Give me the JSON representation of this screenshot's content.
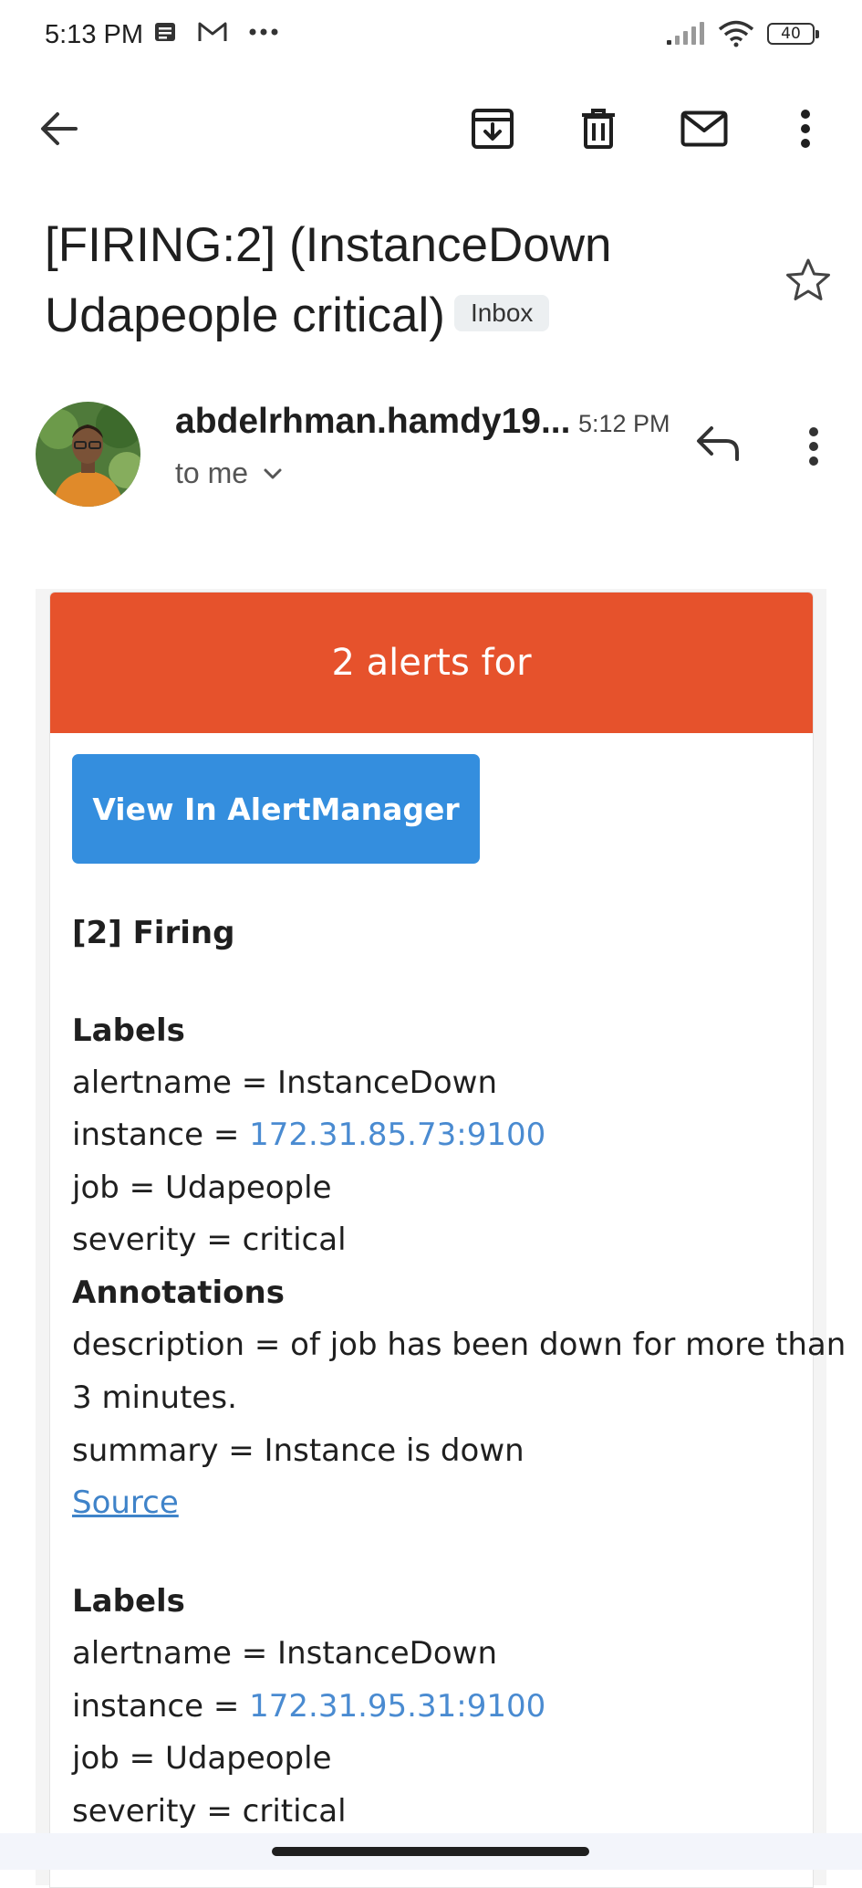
{
  "status_bar": {
    "time": "5:13 PM",
    "battery": "40"
  },
  "message": {
    "subject": "[FIRING:2]  (InstanceDown Udapeople critical)",
    "label": "Inbox",
    "sender": "abdelrhman.hamdy19...",
    "time": "5:12 PM",
    "recipient": "to me"
  },
  "email_body": {
    "banner": "2 alerts for",
    "button": "View In AlertManager",
    "firing_header": "[2] Firing",
    "alerts": [
      {
        "labels_header": "Labels",
        "alertname_prefix": "alertname = ",
        "alertname": "InstanceDown",
        "instance_prefix": "instance = ",
        "instance": "172.31.85.73:9100",
        "job_prefix": "job = ",
        "job": "Udapeople",
        "severity_prefix": "severity = ",
        "severity": "critical",
        "annotations_header": "Annotations",
        "description_line1": "description = of job has been down for more than",
        "description_line2": "3 minutes.",
        "summary": "summary = Instance is down",
        "source": "Source"
      },
      {
        "labels_header": "Labels",
        "alertname_prefix": "alertname = ",
        "alertname": "InstanceDown",
        "instance_prefix": "instance = ",
        "instance": "172.31.95.31:9100",
        "job_prefix": "job = ",
        "job": "Udapeople",
        "severity_prefix": "severity = ",
        "severity": "critical"
      }
    ]
  },
  "icons": {
    "back": "arrow-back-icon",
    "archive": "archive-icon",
    "delete": "trash-icon",
    "mark_unread": "mail-icon",
    "more": "more-vert-icon",
    "star": "star-icon",
    "reply": "reply-icon"
  },
  "colors": {
    "banner": "#e6522c",
    "button": "#348ede",
    "link": "#4a8bd1"
  }
}
